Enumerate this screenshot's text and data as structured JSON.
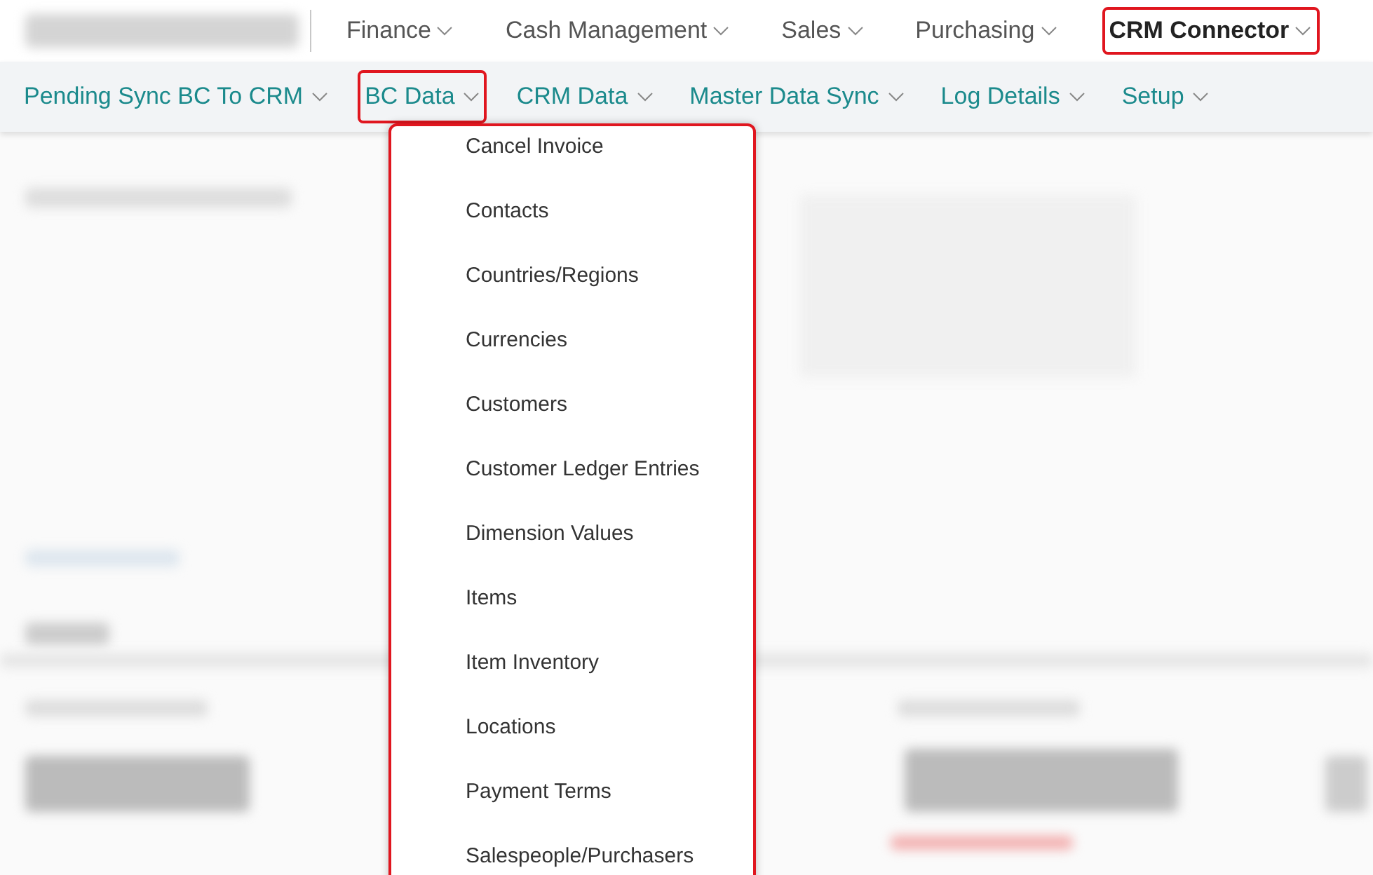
{
  "top_menu": [
    {
      "label": "Finance",
      "highlighted": false
    },
    {
      "label": "Cash Management",
      "highlighted": false
    },
    {
      "label": "Sales",
      "highlighted": false
    },
    {
      "label": "Purchasing",
      "highlighted": false
    },
    {
      "label": "CRM Connector",
      "highlighted": true
    }
  ],
  "sub_menu": [
    {
      "label": "Pending Sync BC To CRM",
      "highlighted": false
    },
    {
      "label": "BC Data",
      "highlighted": true
    },
    {
      "label": "CRM Data",
      "highlighted": false
    },
    {
      "label": "Master Data Sync",
      "highlighted": false
    },
    {
      "label": "Log Details",
      "highlighted": false
    },
    {
      "label": "Setup",
      "highlighted": false
    }
  ],
  "dropdown": {
    "highlighted": true,
    "items": [
      "Cancel Invoice",
      "Contacts",
      "Countries/Regions",
      "Currencies",
      "Customers",
      "Customer Ledger Entries",
      "Dimension Values",
      "Items",
      "Item Inventory",
      "Locations",
      "Payment Terms",
      "Salespeople/Purchasers"
    ]
  }
}
